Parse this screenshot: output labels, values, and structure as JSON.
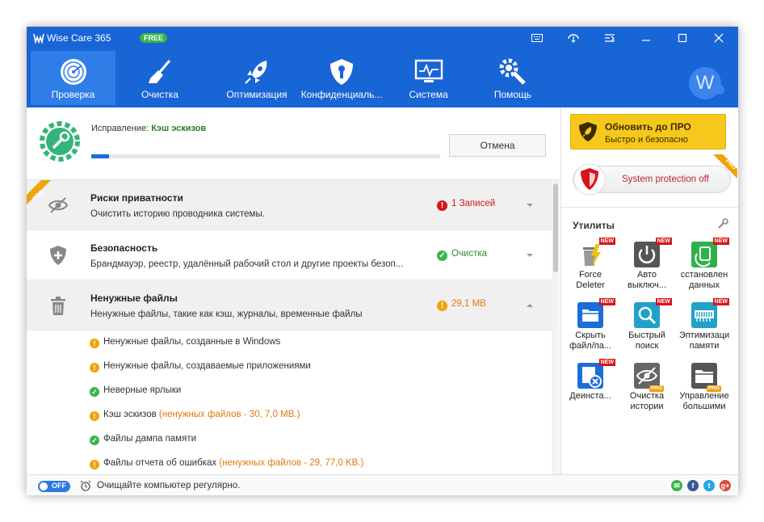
{
  "window": {
    "title": "Wise Care 365",
    "badge": "FREE"
  },
  "nav": [
    {
      "label": "Проверка",
      "icon": "radar-icon"
    },
    {
      "label": "Очистка",
      "icon": "broom-icon"
    },
    {
      "label": "Оптимизация",
      "icon": "rocket-icon"
    },
    {
      "label": "Конфиденциаль...",
      "icon": "privacy-shield-icon"
    },
    {
      "label": "Система",
      "icon": "monitor-icon"
    },
    {
      "label": "Помощь",
      "icon": "tools-icon"
    }
  ],
  "avatar": {
    "letter": "W"
  },
  "scan": {
    "label_prefix": "Исправление: ",
    "label_value": "Кэш эскизов",
    "progress": 0.05,
    "cancel": "Отмена"
  },
  "items": [
    {
      "title": "Риски приватности",
      "desc": "Очистить историю проводника системы.",
      "status": "1 Записей",
      "status_type": "error",
      "pro": "PRO"
    },
    {
      "title": "Безопасность",
      "desc": "Брандмауэр, реестр, удалённый рабочий стол и другие проекты безоп...",
      "status": "Очистка",
      "status_type": "ok"
    },
    {
      "title": "Ненужные файлы",
      "desc": "Ненужные файлы, такие как кэш, журналы, временные файлы",
      "status": "29,1 MB",
      "status_type": "warn"
    }
  ],
  "sub_items": [
    {
      "text": "Ненужные файлы, созданные в Windows",
      "extra": "",
      "type": "warn"
    },
    {
      "text": "Ненужные файлы, создаваемые приложениями",
      "extra": "",
      "type": "warn"
    },
    {
      "text": "Неверные ярлыки",
      "extra": "",
      "type": "ok"
    },
    {
      "text": "Кэш эскизов ",
      "extra": "(ненужных файлов - 30, 7,0 MB.)",
      "type": "warn"
    },
    {
      "text": "Файлы дампа памяти",
      "extra": "",
      "type": "ok"
    },
    {
      "text": "Файлы отчета об ошибках ",
      "extra": "(ненужных файлов - 29, 77,0 KB.)",
      "type": "warn"
    }
  ],
  "upgrade": {
    "title": "Обновить до ПРО",
    "subtitle": "Быстро и безопасно"
  },
  "protection": {
    "label": "System protection off",
    "pro": "PRO"
  },
  "utilities": {
    "title": "Утилиты",
    "tools": [
      {
        "label": "Force\nDeleter",
        "badge": "NEW"
      },
      {
        "label": "Авто\nвыключ...",
        "badge": "NEW"
      },
      {
        "label": "сстановлен\nданных",
        "badge": "NEW"
      },
      {
        "label": "Скрыть\nфайл/па...",
        "badge": "NEW"
      },
      {
        "label": "Быстрый\nпоиск",
        "badge": "NEW"
      },
      {
        "label": "Эптимизаци\nпамяти",
        "badge": "NEW"
      },
      {
        "label": "Деинста...",
        "badge": "NEW"
      },
      {
        "label": "Очистка\nистории",
        "badge": "PRO"
      },
      {
        "label": "Управление\nбольшими",
        "badge": "PRO"
      }
    ]
  },
  "status_bar": {
    "toggle": "OFF",
    "text": "Очищайте компьютер регулярно."
  },
  "colors": {
    "header": "#1865d6",
    "active_tab": "#2f7de6",
    "warn": "#f0a30a",
    "error": "#d7141a",
    "ok": "#3ab54a"
  }
}
